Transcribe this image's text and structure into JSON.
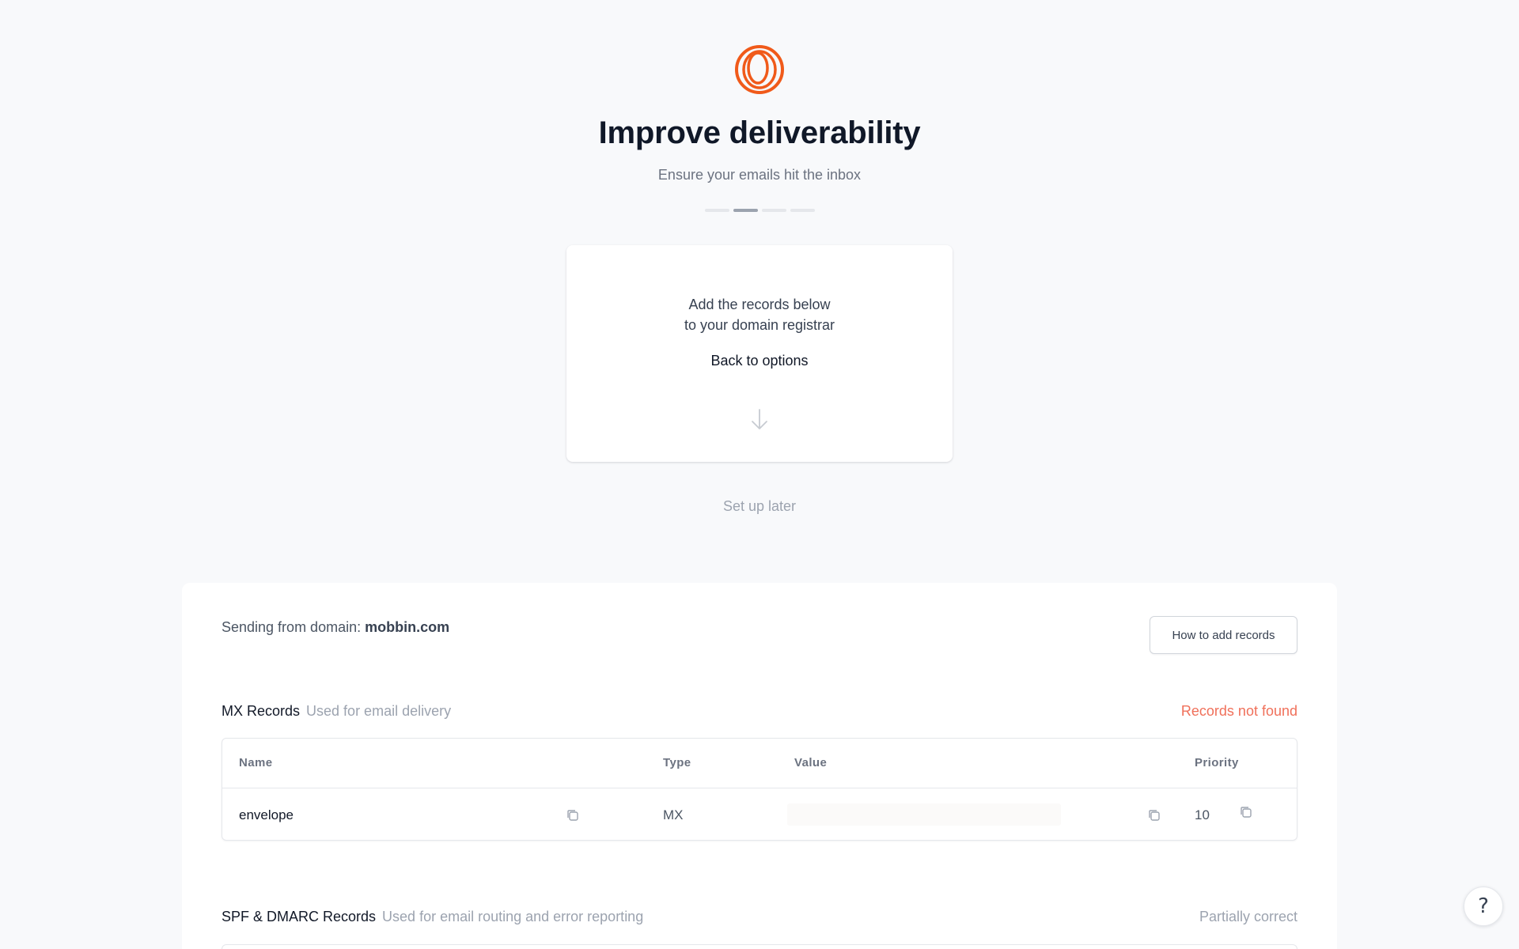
{
  "header": {
    "title": "Improve deliverability",
    "subtitle": "Ensure your emails hit the inbox",
    "steps_total": 4,
    "step_active": 2,
    "logo_icon": "rings-logo-icon",
    "brand_color": "#f05a1a"
  },
  "card": {
    "line1": "Add the records below",
    "line2": "to your domain registrar",
    "back_label": "Back to options",
    "arrow_icon": "arrow-down-icon"
  },
  "setup_later_label": "Set up later",
  "records": {
    "domain_prefix": "Sending from domain:",
    "domain": "mobbin.com",
    "how_button_label": "How to add records",
    "mx": {
      "title": "MX Records",
      "description": "Used for email delivery",
      "status": "Records not found",
      "status_color": "#f0705a",
      "columns": {
        "name": "Name",
        "type": "Type",
        "value": "Value",
        "priority": "Priority"
      },
      "rows": [
        {
          "name": "envelope",
          "type": "MX",
          "value": "",
          "priority": "10"
        }
      ]
    },
    "spf": {
      "title": "SPF & DMARC Records",
      "description": "Used for email routing and error reporting",
      "status": "Partially correct"
    }
  },
  "help_label": "?"
}
